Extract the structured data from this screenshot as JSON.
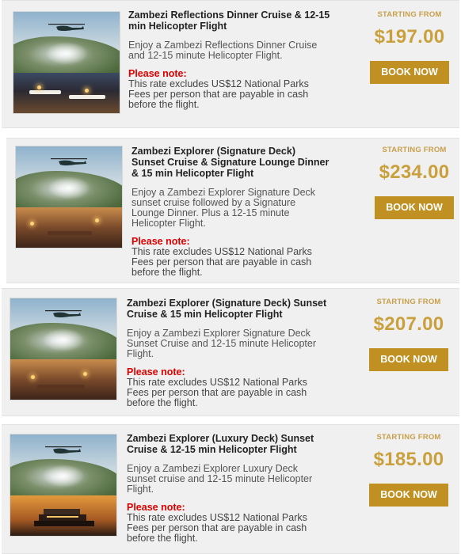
{
  "listings": [
    {
      "title": "Zambezi Reflections Dinner Cruise & 12-15 min Helicopter Flight",
      "description": "Enjoy a Zambezi  Reflections Dinner Cruise and 12-15 minute Helicopter Flight.",
      "note_label": "Please note:",
      "note_text": "This rate excludes US$12 National Parks Fees per person that are payable in cash before the flight.",
      "starting_label": "STARTING FROM",
      "price": "$197.00",
      "book_label": "BOOK NOW"
    },
    {
      "title": "Zambezi Explorer (Signature Deck) Sunset Cruise & Signature Lounge Dinner & 15 min Helicopter Flight",
      "description": "Enjoy a Zambezi Explorer Signature Deck sunset cruise followed by a Signature Lounge Dinner. Plus a 12-15 minute Helicopter Flight.",
      "note_label": "Please note:",
      "note_text": "This rate excludes US$12 National Parks Fees per person that are payable in cash before the flight.",
      "starting_label": "STARTING FROM",
      "price": "$234.00",
      "book_label": "BOOK NOW"
    },
    {
      "title": "Zambezi Explorer (Signature Deck) Sunset Cruise & 15 min Helicopter Flight",
      "description": "Enjoy a Zambezi Explorer Signature Deck Sunset Cruise and 12-15 minute Helicopter Flight.",
      "note_label": "Please note:",
      "note_text": "This rate excludes US$12 National Parks Fees per person that are payable in cash before the flight.",
      "starting_label": "STARTING FROM",
      "price": "$207.00",
      "book_label": "BOOK NOW"
    },
    {
      "title": "Zambezi Explorer (Luxury Deck) Sunset Cruise & 12-15 min Helicopter Flight",
      "description": "Enjoy a Zambezi Explorer Luxury Deck sunset cruise and 12-15 minute Helicopter Flight.",
      "note_label": "Please note:",
      "note_text": "This rate excludes US$12 National Parks Fees per person that are payable in cash before the flight.",
      "starting_label": "STARTING FROM",
      "price": "$185.00",
      "book_label": "BOOK NOW"
    }
  ],
  "colors": {
    "price_gold": "#c9a03c",
    "button_gold": "#c09122",
    "note_red": "#e00000",
    "card_bg": "#f0f0f0"
  }
}
